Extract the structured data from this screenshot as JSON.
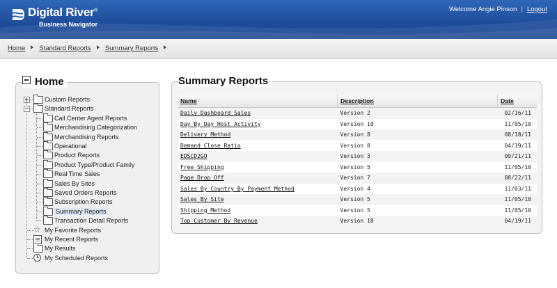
{
  "header": {
    "brand": "Digital River",
    "tm": "®",
    "subtitle": "Business Navigator",
    "welcome": "Welcome Angie Pinson",
    "separator": "|",
    "logout": "Logout",
    "bg_color": "#1f4e9c"
  },
  "breadcrumb": [
    "Home",
    "Standard Reports",
    "Summary Reports"
  ],
  "tree": {
    "title": "Home",
    "items": [
      {
        "label": "Custom Reports",
        "icon": "folder-icon",
        "expander": "plus"
      },
      {
        "label": "Standard Reports",
        "icon": "folder-open-icon",
        "expander": "minus"
      },
      {
        "label": "Call Center Agent Reports",
        "icon": "folder-icon"
      },
      {
        "label": "Merchandising Categorization",
        "icon": "folder-icon"
      },
      {
        "label": "Merchandising Reports",
        "icon": "folder-icon"
      },
      {
        "label": "Operational",
        "icon": "folder-icon"
      },
      {
        "label": "Product Reports",
        "icon": "folder-icon"
      },
      {
        "label": "Product Type/Product Family",
        "icon": "folder-icon"
      },
      {
        "label": "Real Time Sales",
        "icon": "folder-icon"
      },
      {
        "label": "Sales By Sites",
        "icon": "folder-icon"
      },
      {
        "label": "Saved Orders Reports",
        "icon": "folder-icon"
      },
      {
        "label": "Subscription Reports",
        "icon": "folder-icon"
      },
      {
        "label": "Summary Reports",
        "icon": "folder-icon",
        "selected": true
      },
      {
        "label": "Transaction Detail Reports",
        "icon": "folder-icon"
      },
      {
        "label": "My Favorite Reports",
        "icon": "star-icon"
      },
      {
        "label": "My Recent Reports",
        "icon": "document-icon"
      },
      {
        "label": "My Results",
        "icon": "folder-icon"
      },
      {
        "label": "My Scheduled Reports",
        "icon": "clock-icon"
      }
    ]
  },
  "main": {
    "title": "Summary Reports",
    "columns": [
      "Name",
      "Description",
      "Date"
    ],
    "rows": [
      {
        "name": "Daily Dashboard Sales",
        "description": "Version 2",
        "date": "02/16/11"
      },
      {
        "name": "Day By Day Host Activity",
        "description": "Version 10",
        "date": "11/05/10"
      },
      {
        "name": "Delivery Method",
        "description": "Version 8",
        "date": "08/18/11"
      },
      {
        "name": "Demand Close Ratio",
        "description": "Version 8",
        "date": "04/19/11"
      },
      {
        "name": "EDSCD2GO",
        "description": "Version 3",
        "date": "09/21/11"
      },
      {
        "name": "Free Shipping",
        "description": "Version 5",
        "date": "11/05/10"
      },
      {
        "name": "Page Drop Off",
        "description": "Version 7",
        "date": "08/22/11"
      },
      {
        "name": "Sales By Country By Payment Method",
        "description": "Version 4",
        "date": "11/03/11"
      },
      {
        "name": "Sales By Site",
        "description": "Version 5",
        "date": "11/05/10"
      },
      {
        "name": "Shipping Method",
        "description": "Version 5",
        "date": "11/05/10"
      },
      {
        "name": "Top Customer By Revenue",
        "description": "Version 18",
        "date": "04/19/11"
      }
    ]
  }
}
